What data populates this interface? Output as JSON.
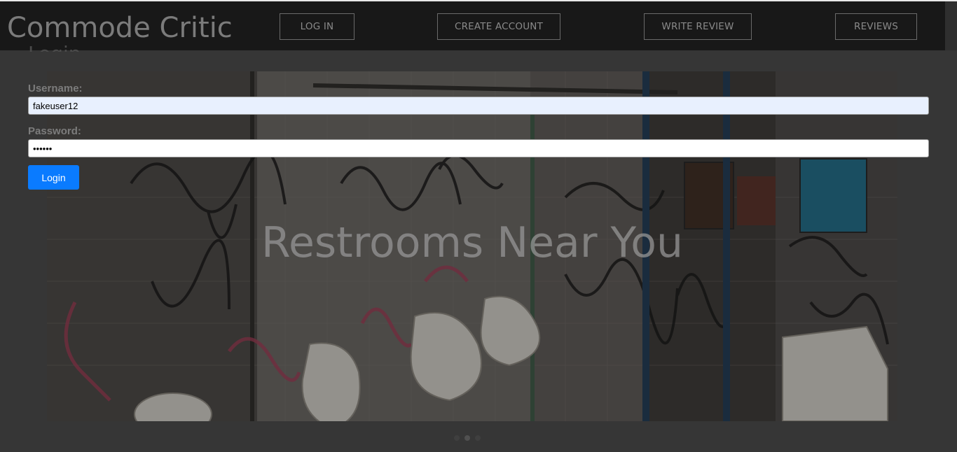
{
  "header": {
    "brand": "Commode Critic",
    "ghost_heading": "Login",
    "nav": {
      "login": "LOG IN",
      "create_account": "CREATE ACCOUNT",
      "write_review": "WRITE REVIEW",
      "reviews": "REVIEWS"
    }
  },
  "login_form": {
    "username_label": "Username:",
    "username_value": "fakeuser12",
    "password_label": "Password:",
    "password_value": "••••••",
    "submit_label": "Login",
    "submit_color": "#0a7bff"
  },
  "hero": {
    "caption": "Restrooms Near You",
    "image_description_icon": "graffiti-restroom-photo"
  },
  "carousel": {
    "slides": 3,
    "active_index": 1
  }
}
